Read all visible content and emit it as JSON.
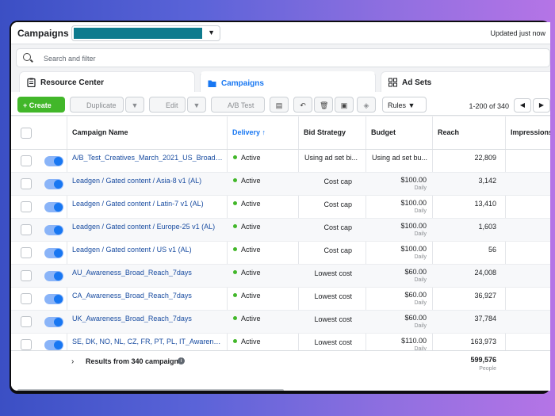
{
  "header": {
    "title": "Campaigns",
    "updated": "Updated just now"
  },
  "search": {
    "placeholder": "Search and filter"
  },
  "tabs": [
    {
      "label": "Resource Center",
      "icon": "clipboard-icon"
    },
    {
      "label": "Campaigns",
      "icon": "folder-icon",
      "active": true
    },
    {
      "label": "Ad Sets",
      "icon": "grid-icon"
    }
  ],
  "toolbar": {
    "create": "+ Create",
    "duplicate": "Duplicate",
    "edit": "Edit",
    "ab_test": "A/B Test",
    "rules": "Rules",
    "range": "1-200 of 340"
  },
  "columns": {
    "name": "Campaign Name",
    "delivery": "Delivery ↑",
    "bid": "Bid Strategy",
    "budget": "Budget",
    "reach": "Reach",
    "impressions": "Impressions"
  },
  "rows": [
    {
      "name": "A/B_Test_Creatives_March_2021_US_Broad_...",
      "delivery": "Active",
      "bid": "Using ad set bi...",
      "budget": "Using ad set bu...",
      "budget_sub": "",
      "reach": "22,809"
    },
    {
      "name": "Leadgen / Gated content / Asia-8 v1 (AL)",
      "delivery": "Active",
      "bid": "Cost cap",
      "budget": "$100.00",
      "budget_sub": "Daily",
      "reach": "3,142"
    },
    {
      "name": "Leadgen / Gated content / Latin-7 v1 (AL)",
      "delivery": "Active",
      "bid": "Cost cap",
      "budget": "$100.00",
      "budget_sub": "Daily",
      "reach": "13,410"
    },
    {
      "name": "Leadgen / Gated content / Europe-25 v1 (AL)",
      "delivery": "Active",
      "bid": "Cost cap",
      "budget": "$100.00",
      "budget_sub": "Daily",
      "reach": "1,603"
    },
    {
      "name": "Leadgen / Gated content / US v1 (AL)",
      "delivery": "Active",
      "bid": "Cost cap",
      "budget": "$100.00",
      "budget_sub": "Daily",
      "reach": "56"
    },
    {
      "name": "AU_Awareness_Broad_Reach_7days",
      "delivery": "Active",
      "bid": "Lowest cost",
      "budget": "$60.00",
      "budget_sub": "Daily",
      "reach": "24,008"
    },
    {
      "name": "CA_Awareness_Broad_Reach_7days",
      "delivery": "Active",
      "bid": "Lowest cost",
      "budget": "$60.00",
      "budget_sub": "Daily",
      "reach": "36,927"
    },
    {
      "name": "UK_Awareness_Broad_Reach_7days",
      "delivery": "Active",
      "bid": "Lowest cost",
      "budget": "$60.00",
      "budget_sub": "Daily",
      "reach": "37,784"
    },
    {
      "name": "SE, DK, NO, NL, CZ, FR, PT, PL, IT_Awareness_...",
      "delivery": "Active",
      "bid": "Lowest cost",
      "budget": "$110.00",
      "budget_sub": "Daily",
      "reach": "163,973"
    }
  ],
  "footer": {
    "results": "Results from 340 campaigns",
    "total_reach": "599,576",
    "total_reach_sub": "People"
  },
  "colors": {
    "accent": "#1877f2",
    "create": "#42b72a",
    "link": "#1a4da1"
  }
}
